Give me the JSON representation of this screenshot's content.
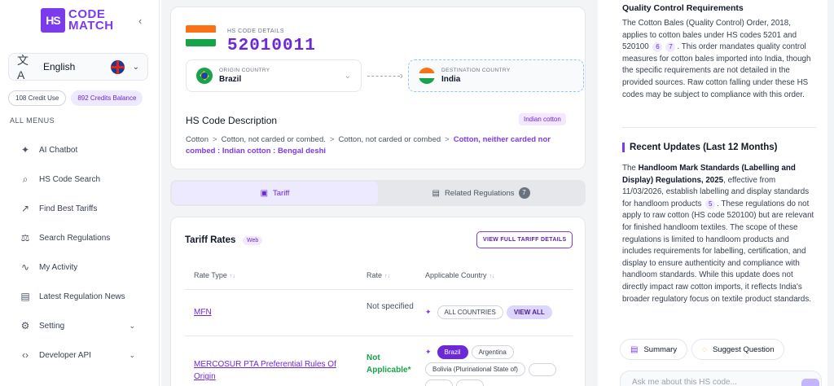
{
  "sidebar": {
    "logo_mark": "HS",
    "logo_line1": "CODE",
    "logo_line2": "MATCH",
    "language": "English",
    "credit_use": "108 Credit Use",
    "credits_balance": "892 Credits Balance",
    "menus_title": "ALL MENUS",
    "items": [
      {
        "label": "AI Chatbot",
        "icon": "sparkle-icon"
      },
      {
        "label": "HS Code Search",
        "icon": "search-icon"
      },
      {
        "label": "Find Best Tariffs",
        "icon": "trend-icon"
      },
      {
        "label": "Search Regulations",
        "icon": "scale-icon"
      },
      {
        "label": "My Activity",
        "icon": "heartbeat-icon"
      },
      {
        "label": "Latest Regulation News",
        "icon": "news-icon"
      },
      {
        "label": "Setting",
        "icon": "gear-icon"
      },
      {
        "label": "Developer API",
        "icon": "code-icon"
      }
    ]
  },
  "hs": {
    "label": "HS CODE DETAILS",
    "code": "52010011",
    "origin_label": "ORIGIN COUNTRY",
    "origin": "Brazil",
    "dest_label": "DESTINATION COUNTRY",
    "dest": "India",
    "desc_title": "HS Code Description",
    "tag": "Indian cotton",
    "path": [
      "Cotton",
      "Cotton, not carded or combed.",
      "Cotton, not carded or combed"
    ],
    "path_final": "Cotton, neither carded nor combed : Indian cotton : Bengal deshi",
    "sep": ">"
  },
  "tabs": {
    "tariff": "Tariff",
    "related": "Related Regulations",
    "related_count": "7"
  },
  "tariff": {
    "title": "Tariff Rates",
    "web_tag": "Web",
    "view_full": "VIEW FULL TARIFF DETAILS",
    "col_type": "Rate Type",
    "col_rate": "Rate",
    "col_country": "Applicable Country",
    "sort": "↑↓",
    "rows": [
      {
        "type": "MFN",
        "rate": "Not specified",
        "chips": [
          "ALL COUNTRIES"
        ],
        "view_all": "VIEW ALL"
      },
      {
        "type": "MERCOSUR PTA Preferential Rules Of Origin",
        "rate": "Not Applicable*",
        "chips": [
          "Brazil",
          "Argentina",
          "Bolivia (Plurinational State of)"
        ]
      }
    ]
  },
  "right": {
    "qc_heading": "Quality Control Requirements",
    "qc_text_1": "The Cotton Bales (Quality Control) Order, 2018, applies to cotton bales under HS codes 5201 and 520100",
    "qc_cite_1": "6",
    "qc_cite_2": "7",
    "qc_text_2": ". This order mandates quality control measures for cotton bales imported into India, though the specific requirements are not detailed in the provided sources. Raw cotton falling under these HS codes may be subject to compliance with this order.",
    "recent_heading": "Recent Updates (Last 12 Months)",
    "ru_text_1": "The",
    "ru_bold": "Handloom Mark Standards (Labelling and Display) Regulations, 2025",
    "ru_text_2": ", effective from 11/03/2026, establish labelling and display standards for handloom products",
    "ru_cite": "5",
    "ru_text_3": ". These regulations do not apply to raw cotton (HS code 520100) but are relevant for finished handloom textiles. The scope of these regulations is limited to handloom products and includes requirements for labelling, certification, and display to ensure authenticity and compliance with handloom standards. While this update does not directly impact raw cotton imports, it reflects India's broader regulatory focus on textile product standards.",
    "summary_btn": "Summary",
    "suggest_btn": "Suggest Question",
    "ask_placeholder": "Ask me about this HS code..."
  },
  "colors": {
    "accent": "#7c3aed",
    "accent_light": "#ede9fe",
    "green": "#16a34a"
  }
}
